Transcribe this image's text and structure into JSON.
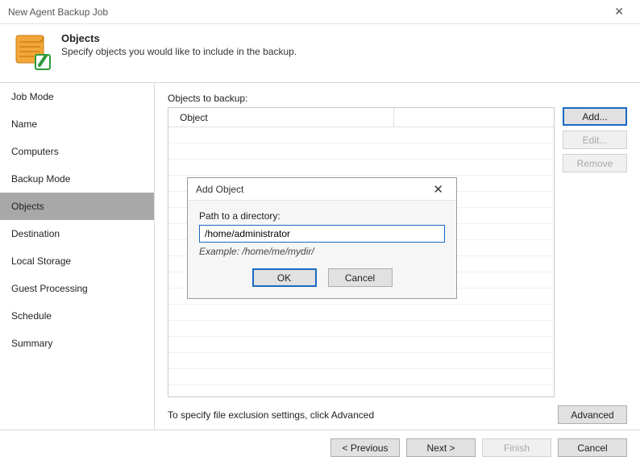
{
  "window": {
    "title": "New Agent Backup Job"
  },
  "header": {
    "title": "Objects",
    "subtitle": "Specify objects you would like to include in the backup."
  },
  "sidebar": {
    "items": [
      {
        "label": "Job Mode"
      },
      {
        "label": "Name"
      },
      {
        "label": "Computers"
      },
      {
        "label": "Backup Mode"
      },
      {
        "label": "Objects"
      },
      {
        "label": "Destination"
      },
      {
        "label": "Local Storage"
      },
      {
        "label": "Guest Processing"
      },
      {
        "label": "Schedule"
      },
      {
        "label": "Summary"
      }
    ],
    "selected_index": 4
  },
  "main": {
    "objects_label": "Objects to backup:",
    "columns": {
      "object": "Object"
    },
    "buttons": {
      "add": "Add...",
      "edit": "Edit...",
      "remove": "Remove"
    },
    "hint": "To specify file exclusion settings, click Advanced",
    "advanced": "Advanced"
  },
  "footer": {
    "previous": "< Previous",
    "next": "Next >",
    "finish": "Finish",
    "cancel": "Cancel"
  },
  "modal": {
    "title": "Add Object",
    "path_label": "Path to a directory:",
    "path_value": "/home/administrator",
    "example": "Example: /home/me/mydir/",
    "ok": "OK",
    "cancel": "Cancel"
  }
}
